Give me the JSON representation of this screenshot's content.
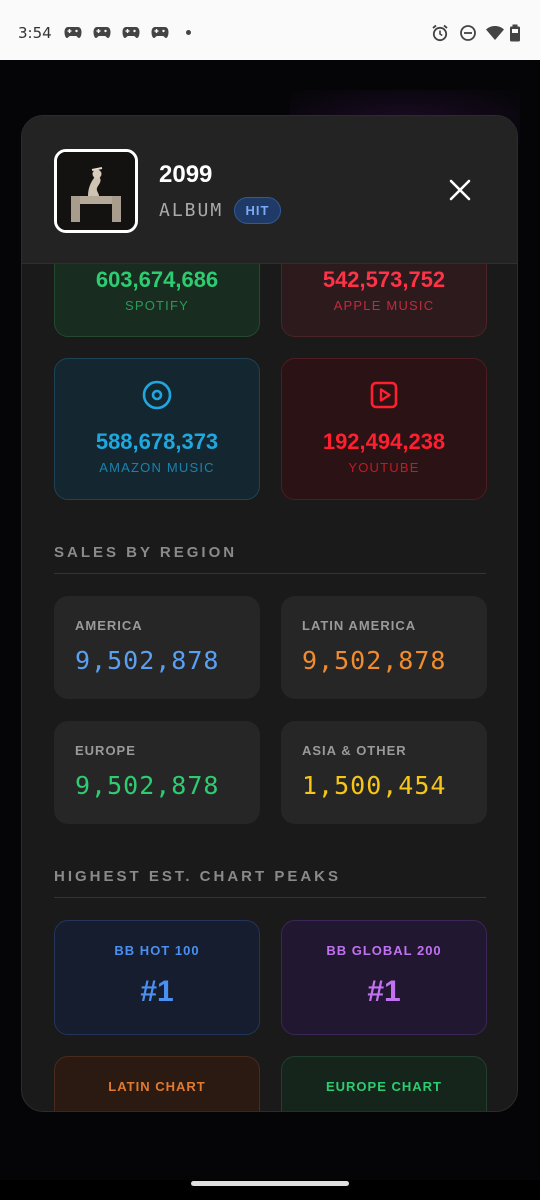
{
  "status_bar": {
    "time": "3:54"
  },
  "album": {
    "title": "2099",
    "type": "ALBUM",
    "badge": "HIT"
  },
  "streams": [
    {
      "value": "603,674,686",
      "label": "SPOTIFY",
      "color": "#2ecc71",
      "bg": "#182c1f",
      "border": "#234a30"
    },
    {
      "value": "542,573,752",
      "label": "APPLE MUSIC",
      "color": "#ff3347",
      "bg": "#2d1a1d",
      "border": "#4a2429"
    },
    {
      "value": "588,678,373",
      "label": "AMAZON MUSIC",
      "color": "#1fa8e0",
      "bg": "#142730",
      "border": "#1d4456",
      "icon": "disc-icon"
    },
    {
      "value": "192,494,238",
      "label": "YOUTUBE",
      "color": "#ff1f2f",
      "bg": "#2b1214",
      "border": "#4e1c21",
      "icon": "play-square-icon"
    }
  ],
  "sections": {
    "region": "SALES BY REGION",
    "peaks": "HIGHEST EST. CHART PEAKS"
  },
  "regions": [
    {
      "label": "AMERICA",
      "value": "9,502,878",
      "color": "#5aa0f0"
    },
    {
      "label": "LATIN AMERICA",
      "value": "9,502,878",
      "color": "#f08c30"
    },
    {
      "label": "EUROPE",
      "value": "9,502,878",
      "color": "#2ecc71"
    },
    {
      "label": "ASIA & OTHER",
      "value": "1,500,454",
      "color": "#f5c518"
    }
  ],
  "peaks": [
    {
      "label": "BB HOT 100",
      "value": "#1",
      "color": "#4a90f0",
      "bg": "#161d2e",
      "border": "#24345a"
    },
    {
      "label": "BB GLOBAL 200",
      "value": "#1",
      "color": "#c072f0",
      "bg": "#221730",
      "border": "#3c2656"
    },
    {
      "label": "LATIN CHART",
      "value": "",
      "color": "#e07a30",
      "bg": "#2b1a12",
      "border": "#4a2c1c"
    },
    {
      "label": "EUROPE CHART",
      "value": "",
      "color": "#2ecc71",
      "bg": "#16251b",
      "border": "#22402d"
    }
  ]
}
